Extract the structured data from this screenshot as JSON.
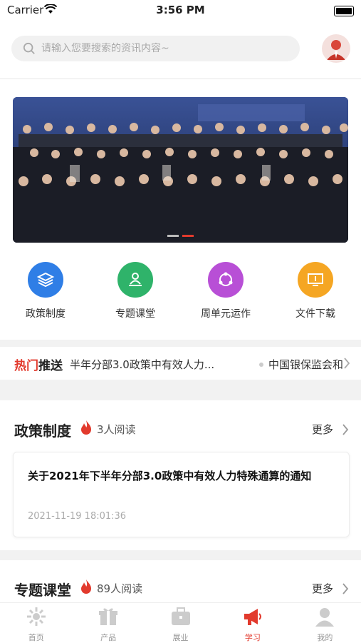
{
  "status": {
    "carrier": "Carrier",
    "time": "3:56 PM"
  },
  "search": {
    "placeholder": "请输入您要搜索的资讯内容~"
  },
  "banner": {
    "dots": 2,
    "active_dot": 2
  },
  "shortcuts": [
    {
      "label": "政策制度",
      "icon": "layers-icon",
      "color": "#2f7ee6"
    },
    {
      "label": "专题课堂",
      "icon": "person-podium-icon",
      "color": "#2fb36a"
    },
    {
      "label": "周单元运作",
      "icon": "share-network-icon",
      "color": "#b84fd6"
    },
    {
      "label": "文件下载",
      "icon": "monitor-download-icon",
      "color": "#f5a623"
    }
  ],
  "hot": {
    "tag_red": "热门",
    "tag_dark": "推送",
    "items": [
      "半年分部3.0政策中有效人力...",
      "中国银保监会和"
    ]
  },
  "policy": {
    "title": "政策制度",
    "reads": "3人阅读",
    "more": "更多",
    "article": {
      "title": "关于2021年下半年分部3.0政策中有效人力特殊通算的通知",
      "date": "2021-11-19 18:01:36"
    }
  },
  "course": {
    "title": "专题课堂",
    "reads": "89人阅读",
    "more": "更多"
  },
  "tabs": [
    {
      "label": "首页",
      "icon": "home-sun-icon"
    },
    {
      "label": "产品",
      "icon": "gift-icon"
    },
    {
      "label": "展业",
      "icon": "briefcase-icon"
    },
    {
      "label": "学习",
      "icon": "megaphone-icon",
      "active": true
    },
    {
      "label": "我的",
      "icon": "user-icon"
    }
  ],
  "colors": {
    "accent": "#e23a2d"
  }
}
